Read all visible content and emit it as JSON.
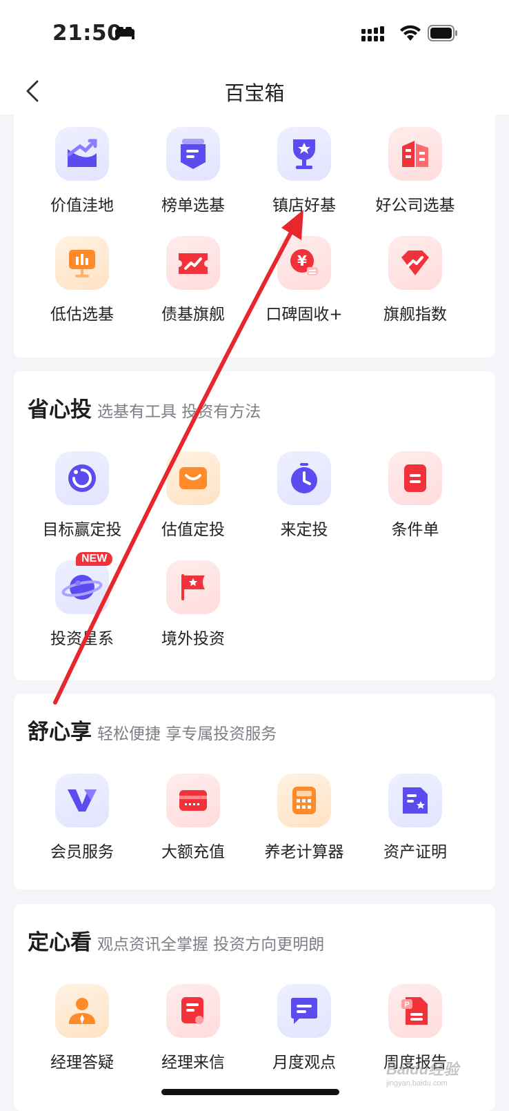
{
  "status_bar": {
    "time": "21:50"
  },
  "nav": {
    "title": "百宝箱"
  },
  "sections": [
    {
      "title": "",
      "subtitle": "",
      "tools": [
        {
          "label": "价值洼地",
          "icon": "trend-chart-icon"
        },
        {
          "label": "榜单选基",
          "icon": "ranking-list-icon"
        },
        {
          "label": "镇店好基",
          "icon": "trophy-icon"
        },
        {
          "label": "好公司选基",
          "icon": "building-icon"
        },
        {
          "label": "低估选基",
          "icon": "presentation-chart-icon"
        },
        {
          "label": "债基旗舰",
          "icon": "ticket-icon"
        },
        {
          "label": "口碑固收+",
          "icon": "yuan-coin-icon"
        },
        {
          "label": "旗舰指数",
          "icon": "diamond-icon"
        }
      ]
    },
    {
      "title": "省心投",
      "subtitle": "选基有工具 投资有方法",
      "tools": [
        {
          "label": "目标赢定投",
          "icon": "target-circle-icon"
        },
        {
          "label": "估值定投",
          "icon": "wallet-icon"
        },
        {
          "label": "来定投",
          "icon": "stopwatch-icon"
        },
        {
          "label": "条件单",
          "icon": "document-icon"
        },
        {
          "label": "投资星系",
          "icon": "planet-icon",
          "badge": "NEW"
        },
        {
          "label": "境外投资",
          "icon": "flag-icon"
        }
      ]
    },
    {
      "title": "舒心享",
      "subtitle": "轻松便捷 享专属投资服务",
      "tools": [
        {
          "label": "会员服务",
          "icon": "vip-v-icon"
        },
        {
          "label": "大额充值",
          "icon": "card-icon"
        },
        {
          "label": "养老计算器",
          "icon": "calculator-icon"
        },
        {
          "label": "资产证明",
          "icon": "certificate-icon"
        }
      ]
    },
    {
      "title": "定心看",
      "subtitle": "观点资讯全掌握 投资方向更明朗",
      "tools": [
        {
          "label": "经理答疑",
          "icon": "manager-icon"
        },
        {
          "label": "经理来信",
          "icon": "letter-icon"
        },
        {
          "label": "月度观点",
          "icon": "chat-bubble-icon"
        },
        {
          "label": "周度报告",
          "icon": "ppt-report-icon"
        }
      ]
    }
  ],
  "watermark": {
    "text": "Baidu经验",
    "sub": "jingyan.baidu.com"
  },
  "colors": {
    "accent_red": "#f2323a",
    "accent_purple": "#5b4cf0",
    "accent_orange": "#ff8a2a"
  }
}
